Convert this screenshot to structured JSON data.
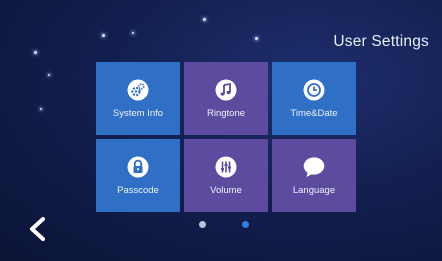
{
  "header": {
    "title": "User Settings"
  },
  "tiles": [
    {
      "label": "System Info",
      "icon": "gears-icon"
    },
    {
      "label": "Ringtone",
      "icon": "music-note-icon"
    },
    {
      "label": "Time&Date",
      "icon": "clock-icon"
    },
    {
      "label": "Passcode",
      "icon": "lock-icon"
    },
    {
      "label": "Volume",
      "icon": "volume-sliders-icon"
    },
    {
      "label": "Language",
      "icon": "speech-bubble-icon"
    }
  ],
  "pagination": {
    "pages": 2,
    "active_page": 2
  },
  "colors": {
    "tile_blue": "#2f6fc5",
    "tile_purple": "#5c4b9f",
    "dot_inactive": "#b9c3d9",
    "dot_active": "#2e7fe0"
  }
}
